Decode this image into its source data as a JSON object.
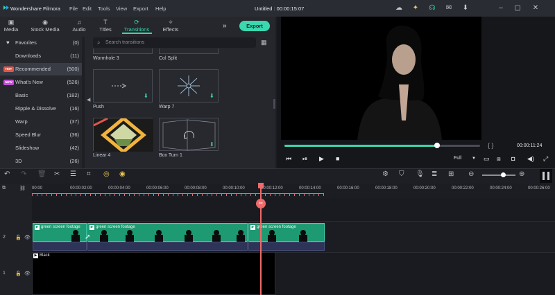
{
  "app": {
    "name": "Wondershare Filmora",
    "project_title": "Untitled : 00:00:15:07"
  },
  "menu": [
    "File",
    "Edit",
    "Tools",
    "View",
    "Export",
    "Help"
  ],
  "title_icons": [
    "cloud-icon",
    "bulb-icon",
    "headset-icon",
    "message-icon",
    "download-icon",
    "minimize-icon",
    "maximize-icon",
    "close-icon"
  ],
  "tabs": [
    {
      "label": "Media",
      "icon": "folder-icon"
    },
    {
      "label": "Stock Media",
      "icon": "stock-icon"
    },
    {
      "label": "Audio",
      "icon": "music-icon"
    },
    {
      "label": "Titles",
      "icon": "text-icon"
    },
    {
      "label": "Transitions",
      "icon": "transition-icon",
      "active": true
    },
    {
      "label": "Effects",
      "icon": "effects-icon"
    }
  ],
  "export_label": "Export",
  "search_placeholder": "Search transitions",
  "categories": [
    {
      "label": "Favorites",
      "count": "(0)"
    },
    {
      "label": "Downloads",
      "count": "(11)"
    },
    {
      "label": "Recommended",
      "count": "(500)",
      "badge": "HOT",
      "selected": true
    },
    {
      "label": "What's New",
      "count": "(526)",
      "badge": "NEW"
    },
    {
      "label": "Basic",
      "count": "(182)"
    },
    {
      "label": "Ripple & Dissolve",
      "count": "(16)"
    },
    {
      "label": "Warp",
      "count": "(37)"
    },
    {
      "label": "Speed Blur",
      "count": "(36)"
    },
    {
      "label": "Slideshow",
      "count": "(42)"
    },
    {
      "label": "3D",
      "count": "(26)"
    }
  ],
  "transitions": [
    {
      "name": "Wormhole 3"
    },
    {
      "name": "Col Split"
    },
    {
      "name": "Push"
    },
    {
      "name": "Warp 7"
    },
    {
      "name": "Linear 4"
    },
    {
      "name": "Box Turn 1"
    }
  ],
  "player": {
    "progress": 0.78,
    "timecode": "00:00:11:24",
    "quality": "Full",
    "brackets": "{    }"
  },
  "ruler_ticks": [
    "00:00",
    "00:00:02:00",
    "00:00:04:00",
    "00:00:06:00",
    "00:00:08:00",
    "00:00:10:00",
    "00:00:12:00",
    "00:00:14:00",
    "00:00:16:00",
    "00:00:18:00",
    "00:00:20:00",
    "00:00:22:00",
    "00:00:24:00",
    "00:00:26:00"
  ],
  "clips": [
    {
      "title": "green screen footage"
    },
    {
      "title": "green screen footage"
    },
    {
      "title": "green screen footage"
    }
  ],
  "black_clip": "Black",
  "track_labels": [
    "2",
    "1"
  ],
  "colors": {
    "accent": "#3bd8b0",
    "playhead": "#f06a6a",
    "clip": "#1e9a72"
  }
}
